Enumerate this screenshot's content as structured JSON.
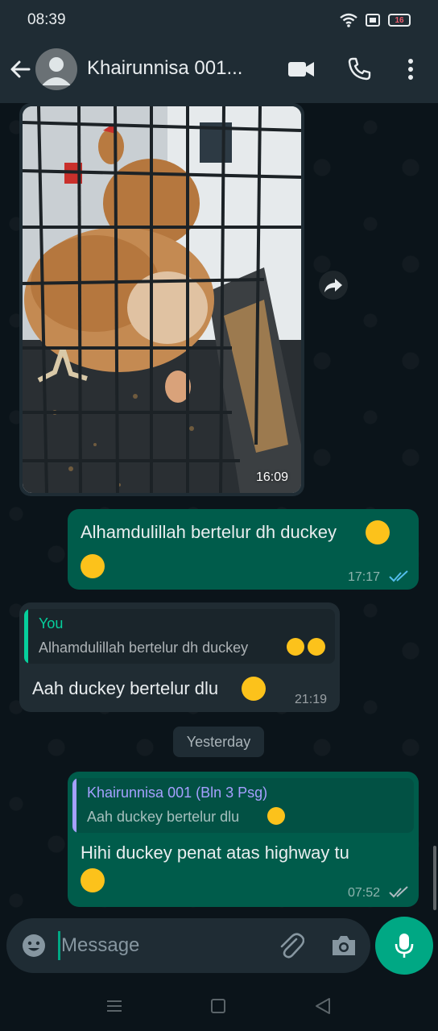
{
  "status_bar": {
    "time": "08:39",
    "battery": "16",
    "icons": [
      "wifi-icon",
      "notification-icon",
      "battery-icon"
    ]
  },
  "header": {
    "contact_name": "Khairunnisa 001...",
    "icons": [
      "back-arrow-icon",
      "avatar-icon",
      "video-call-icon",
      "phone-icon",
      "more-vert-icon"
    ]
  },
  "messages": {
    "image_message": {
      "time": "16:09",
      "image_subject": "photo-of-hen-and-egg-in-cage"
    },
    "msg1": {
      "text": "Alhamdulillah bertelur dh duckey",
      "emojis": [
        "hand-over-mouth-emoji",
        "hand-over-mouth-emoji"
      ],
      "time": "17:17",
      "read": true
    },
    "msg2": {
      "quote_author": "You",
      "quote_text": "Alhamdulillah bertelur dh duckey",
      "quote_emojis": [
        "hand-over-mouth-emoji",
        "hand-over-mouth-emoji"
      ],
      "text": "Aah duckey bertelur dlu",
      "emoji": "tears-of-joy-emoji",
      "time": "21:19"
    },
    "date_separator": "Yesterday",
    "msg3": {
      "quote_author": "Khairunnisa 001 (Bln 3 Psg)",
      "quote_text": "Aah duckey bertelur dlu",
      "quote_emoji": "tears-of-joy-emoji",
      "text": "Hihi duckey penat atas highway tu",
      "emoji": "tears-of-joy-emoji",
      "time": "07:52",
      "read": false
    }
  },
  "composer": {
    "placeholder": "Message",
    "icons": [
      "emoji-icon",
      "attach-icon",
      "camera-icon",
      "mic-icon"
    ]
  },
  "colors": {
    "header_bg": "#1f2c34",
    "chat_bg": "#0b141a",
    "outgoing_bubble": "#005c4b",
    "incoming_bubble": "#202c33",
    "accent": "#00a884",
    "read_ticks": "#53bdeb",
    "quote_you": "#06cf9c",
    "quote_contact": "#a5a0ff"
  }
}
